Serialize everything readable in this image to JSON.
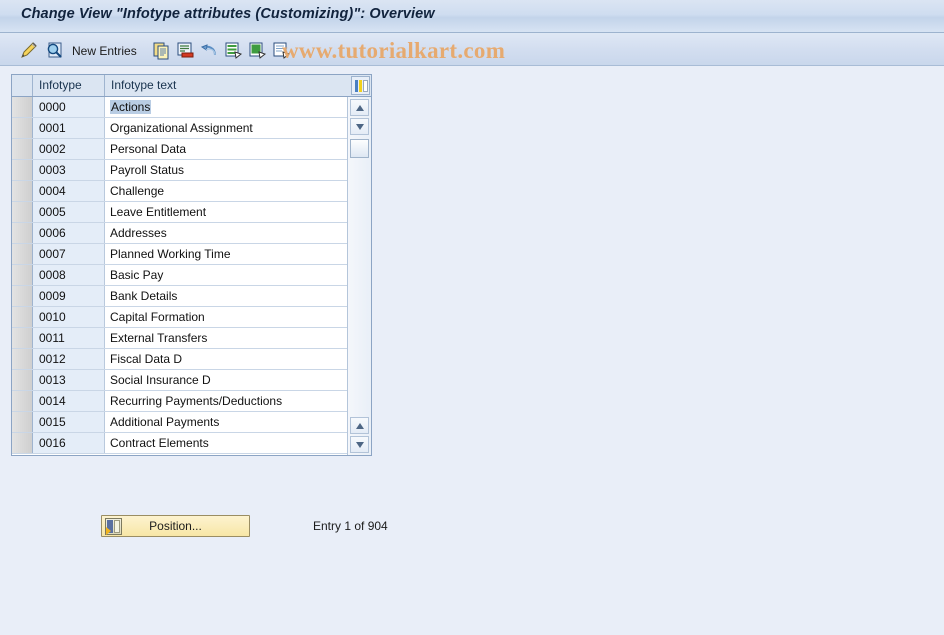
{
  "window": {
    "title": "Change View \"Infotype attributes (Customizing)\": Overview"
  },
  "watermark": {
    "text": "www.tutorialkart.com",
    "color": "#e8a86a"
  },
  "toolbar": {
    "new_entries_label": "New Entries",
    "icons": [
      {
        "name": "display-change-icon",
        "title": "Display <-> Change"
      },
      {
        "name": "other-view-icon",
        "title": "Other view"
      },
      {
        "name": "copy-as-icon",
        "title": "Copy As..."
      },
      {
        "name": "delete-icon",
        "title": "Delete"
      },
      {
        "name": "undo-icon",
        "title": "Undo Change"
      },
      {
        "name": "select-all-icon",
        "title": "Select All"
      },
      {
        "name": "deselect-all-icon",
        "title": "Deselect All"
      },
      {
        "name": "details-icon",
        "title": "Details"
      }
    ]
  },
  "grid": {
    "columns": [
      "Infotype",
      "Infotype text"
    ],
    "selected_row_index": 0,
    "rows": [
      {
        "infotype": "0000",
        "text": "Actions"
      },
      {
        "infotype": "0001",
        "text": "Organizational Assignment"
      },
      {
        "infotype": "0002",
        "text": "Personal Data"
      },
      {
        "infotype": "0003",
        "text": "Payroll Status"
      },
      {
        "infotype": "0004",
        "text": "Challenge"
      },
      {
        "infotype": "0005",
        "text": "Leave Entitlement"
      },
      {
        "infotype": "0006",
        "text": "Addresses"
      },
      {
        "infotype": "0007",
        "text": "Planned Working Time"
      },
      {
        "infotype": "0008",
        "text": "Basic Pay"
      },
      {
        "infotype": "0009",
        "text": "Bank Details"
      },
      {
        "infotype": "0010",
        "text": "Capital Formation"
      },
      {
        "infotype": "0011",
        "text": "External Transfers"
      },
      {
        "infotype": "0012",
        "text": "Fiscal Data  D"
      },
      {
        "infotype": "0013",
        "text": "Social Insurance  D"
      },
      {
        "infotype": "0014",
        "text": "Recurring Payments/Deductions"
      },
      {
        "infotype": "0015",
        "text": "Additional Payments"
      },
      {
        "infotype": "0016",
        "text": "Contract Elements"
      }
    ]
  },
  "footer": {
    "position_button_label": "Position...",
    "entry_status": "Entry 1 of 904"
  }
}
